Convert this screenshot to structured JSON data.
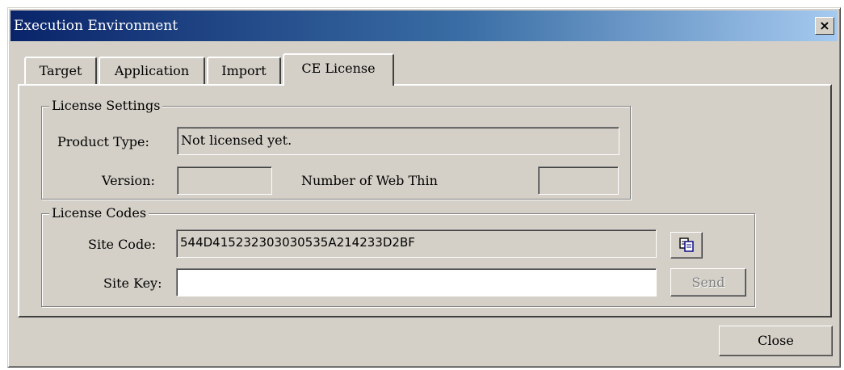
{
  "window": {
    "title": "Execution Environment",
    "close_glyph": "×"
  },
  "tabs": [
    {
      "label": "Target"
    },
    {
      "label": "Application"
    },
    {
      "label": "Import"
    },
    {
      "label": "CE License",
      "active": true
    }
  ],
  "license_settings": {
    "legend": "License Settings",
    "product_type_label": "Product Type:",
    "product_type_value": "Not licensed yet.",
    "version_label": "Version:",
    "version_value": "",
    "web_thin_label": "Number of Web Thin",
    "web_thin_value": ""
  },
  "license_codes": {
    "legend": "License Codes",
    "site_code_label": "Site Code:",
    "site_code_value": "544D415232303030535A214233D2BF",
    "copy_icon": "copy-icon",
    "site_key_label": "Site Key:",
    "site_key_value": "",
    "send_label": "Send"
  },
  "footer": {
    "close_label": "Close"
  },
  "colors": {
    "face": "#d4d0c8",
    "title_start": "#0a246a",
    "title_end": "#a6caf0",
    "disabled_text": "#808080"
  }
}
